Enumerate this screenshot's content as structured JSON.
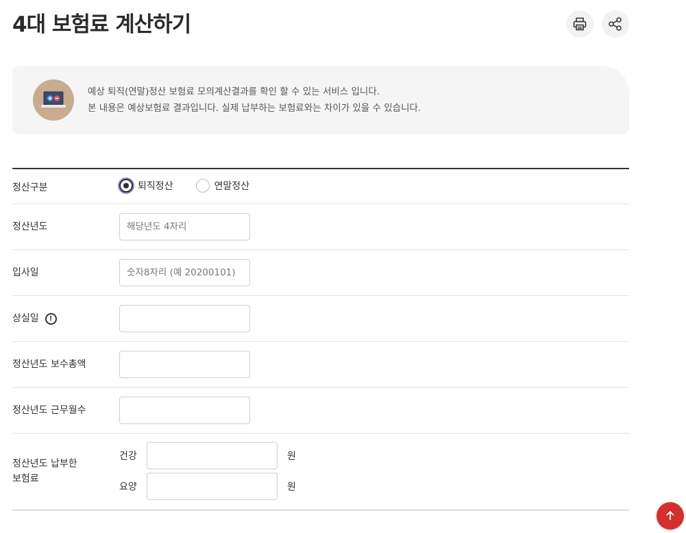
{
  "page": {
    "title": "4대 보험료 계산하기"
  },
  "toolbar": {
    "print_icon": "printer-icon",
    "share_icon": "share-icon"
  },
  "notice": {
    "icon": "calculator-laptop-icon",
    "line1": "예상 퇴직(연말)정산 보험료 모의계산결과를 확인 할 수 있는 서비스 입니다.",
    "line2": "본 내용은 예상보험료 결과입니다. 실제 납부하는 보험료와는 차이가 있을 수 있습니다."
  },
  "form": {
    "settlement_type": {
      "label": "정산구분",
      "options": [
        {
          "label": "퇴직정산",
          "checked": true
        },
        {
          "label": "연말정산",
          "checked": false
        }
      ]
    },
    "settlement_year": {
      "label": "정산년도",
      "value": "",
      "placeholder": "해당년도 4자리"
    },
    "join_date": {
      "label": "입사일",
      "value": "",
      "placeholder": "숫자8자리 (예 20200101)"
    },
    "loss_date": {
      "label": "상실일",
      "info_icon": "info-icon",
      "value": "",
      "placeholder": ""
    },
    "total_pay": {
      "label": "정산년도 보수총액",
      "value": "",
      "placeholder": ""
    },
    "work_months": {
      "label": "정산년도 근무월수",
      "value": "",
      "placeholder": ""
    },
    "paid_insurance": {
      "label_line1": "정산년도 납부한",
      "label_line2": "보험료",
      "health": {
        "label": "건강",
        "value": "",
        "unit": "원"
      },
      "care": {
        "label": "요양",
        "value": "",
        "unit": "원"
      }
    }
  },
  "scroll_top": {
    "icon": "arrow-up-icon"
  },
  "colors": {
    "accent": "#d32f2f",
    "notice_bg": "#f5f5f5",
    "avatar_bg": "#c9ab90"
  }
}
